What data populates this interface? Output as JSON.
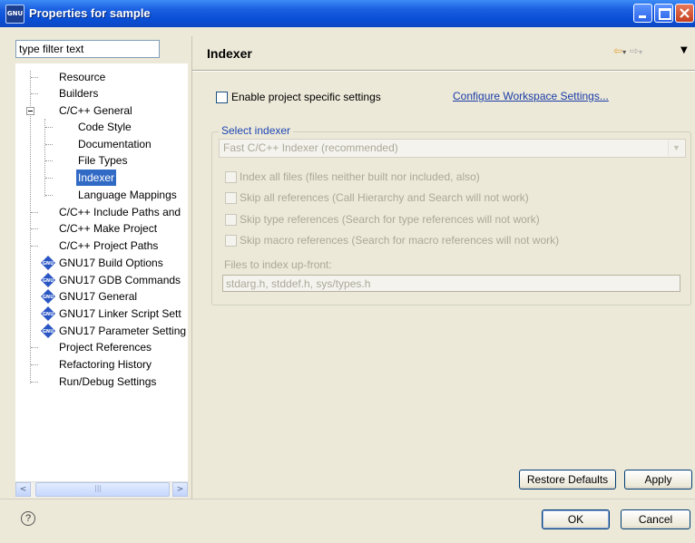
{
  "window": {
    "title": "Properties for sample",
    "icon_text": "GNU",
    "controls": [
      "minimize-icon",
      "maximize-icon",
      "close-icon"
    ]
  },
  "filter": {
    "value": "type filter text"
  },
  "tree": {
    "items": [
      {
        "label": "Resource"
      },
      {
        "label": "Builders"
      },
      {
        "label": "C/C++ General",
        "expanded": true
      },
      {
        "label": "Code Style"
      },
      {
        "label": "Documentation"
      },
      {
        "label": "File Types"
      },
      {
        "label": "Indexer",
        "selected": true
      },
      {
        "label": "Language Mappings"
      },
      {
        "label": "C/C++ Include Paths and"
      },
      {
        "label": "C/C++ Make Project"
      },
      {
        "label": "C/C++ Project Paths"
      },
      {
        "label": "GNU17 Build Options",
        "icon": "gnu-icon"
      },
      {
        "label": "GNU17 GDB Commands",
        "icon": "gnu-icon"
      },
      {
        "label": "GNU17 General",
        "icon": "gnu-icon"
      },
      {
        "label": "GNU17 Linker Script Sett",
        "icon": "gnu-icon"
      },
      {
        "label": "GNU17 Parameter Setting",
        "icon": "gnu-icon"
      },
      {
        "label": "Project References"
      },
      {
        "label": "Refactoring History"
      },
      {
        "label": "Run/Debug Settings"
      }
    ]
  },
  "scrollbar": {
    "left_arrow": "<",
    "right_arrow": ">"
  },
  "page": {
    "title": "Indexer",
    "enable_specific": {
      "label": "Enable project specific settings",
      "checked": false
    },
    "configure_link": "Configure Workspace Settings...",
    "select_indexer": {
      "legend": "Select indexer",
      "combo_value": "Fast C/C++ Indexer (recommended)",
      "options": [
        {
          "label": "Index all files (files neither built nor included, also)",
          "checked": false
        },
        {
          "label": "Skip all references (Call Hierarchy and Search will not work)",
          "checked": false
        },
        {
          "label": "Skip type references (Search for type references will not work)",
          "checked": false
        },
        {
          "label": "Skip macro references (Search for macro references will not work)",
          "checked": false
        }
      ],
      "files_label": "Files to index up-front:",
      "files_value": "stdarg.h, stddef.h, sys/types.h"
    },
    "restore_defaults": "Restore Defaults",
    "apply": "Apply"
  },
  "footer": {
    "help_glyph": "?",
    "ok": "OK",
    "cancel": "Cancel"
  },
  "colors": {
    "titlebar": "#0a4fd6",
    "selection": "#316ac5",
    "link": "#1a3ca8",
    "legend": "#1e46b4",
    "dialog_bg": "#ece9d8"
  }
}
